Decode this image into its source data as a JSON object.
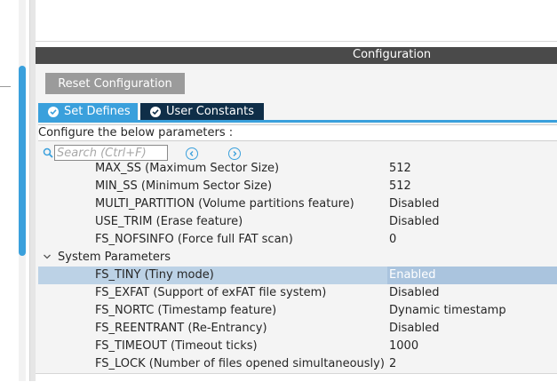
{
  "config": {
    "title": "Configuration",
    "reset_label": "Reset Configuration",
    "tabs": [
      {
        "label": "Set Defines",
        "active": true
      },
      {
        "label": "User Constants",
        "active": false
      }
    ],
    "instructions": "Configure the below parameters :",
    "search": {
      "placeholder": "Search (Ctrl+F)",
      "value": ""
    }
  },
  "params": {
    "rows": [
      {
        "name": "MAX_SS (Maximum Sector Size)",
        "value": "512"
      },
      {
        "name": "MIN_SS (Minimum Sector Size)",
        "value": "512"
      },
      {
        "name": "MULTI_PARTITION (Volume partitions feature)",
        "value": "Disabled"
      },
      {
        "name": "USE_TRIM (Erase feature)",
        "value": "Disabled"
      },
      {
        "name": "FS_NOFSINFO (Force full FAT scan)",
        "value": "0"
      }
    ],
    "group": {
      "name": "System Parameters",
      "expanded": true
    },
    "group_rows": [
      {
        "name": "FS_TINY (Tiny mode)",
        "value": "Enabled",
        "selected": true
      },
      {
        "name": "FS_EXFAT (Support of exFAT file system)",
        "value": "Disabled"
      },
      {
        "name": "FS_NORTC (Timestamp feature)",
        "value": "Dynamic timestamp"
      },
      {
        "name": "FS_REENTRANT (Re-Entrancy)",
        "value": "Disabled"
      },
      {
        "name": "FS_TIMEOUT (Timeout ticks)",
        "value": "1000"
      },
      {
        "name": "FS_LOCK (Number of files opened simultaneously)",
        "value": "2"
      }
    ]
  },
  "colors": {
    "accent": "#3aa0dc",
    "tab_inactive": "#0f2e48",
    "header": "#4a4a4a",
    "selected_row": "#bcd2e6"
  },
  "icons": [
    "check-circle-icon",
    "search-icon",
    "chevron-left-icon",
    "chevron-right-icon",
    "chevron-down-icon"
  ]
}
